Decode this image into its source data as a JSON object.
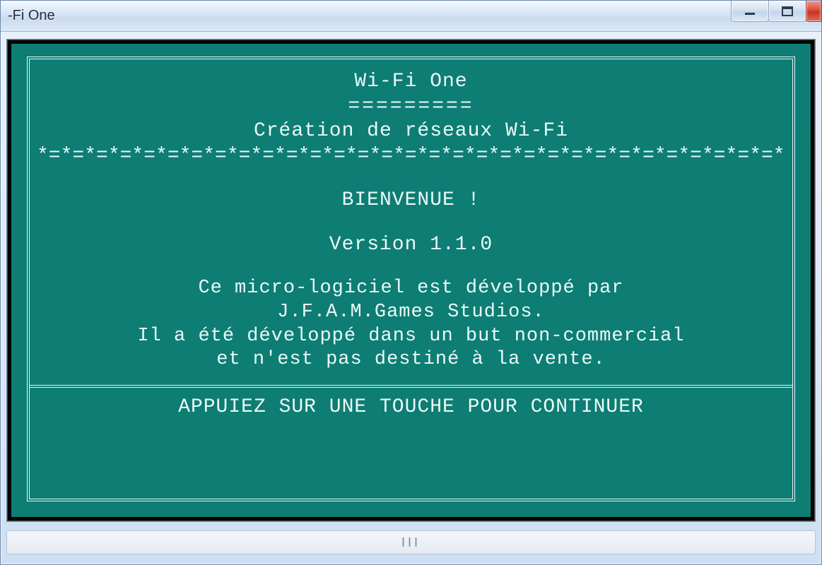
{
  "window": {
    "title": "-Fi One"
  },
  "console": {
    "app_name": "Wi-Fi One",
    "rule_eq": "=========",
    "subtitle": "Création de réseaux Wi-Fi",
    "rule_x": "*=*=*=*=*=*=*=*=*=*=*=*=*=*=*=*=*=*=*=*=*=*=*=*=*=*=*=*=*=*=*=*=*=*=*=*=*=*=*=*=*",
    "welcome": "BIENVENUE !",
    "version": "Version 1.1.0",
    "body_line1": "Ce micro-logiciel est développé par",
    "body_line2": "J.F.A.M.Games Studios.",
    "body_line3": "Il a été développé dans un but non-commercial",
    "body_line4": "et n'est pas destiné à la vente.",
    "prompt": "APPUIEZ SUR UNE TOUCHE POUR CONTINUER"
  },
  "scrollbar": {
    "grip": "III"
  },
  "icons": {
    "minimize": "minimize-icon",
    "maximize": "maximize-icon",
    "close": "close-icon"
  }
}
